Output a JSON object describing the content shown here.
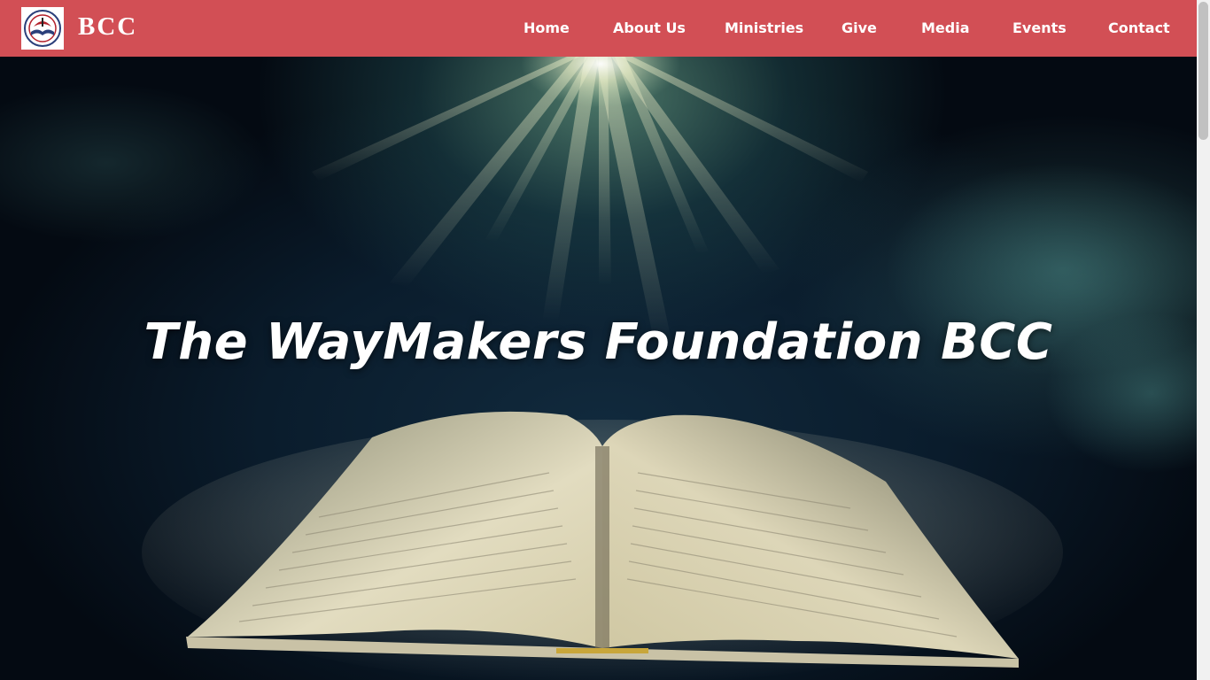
{
  "header": {
    "brand": "BCC",
    "logo_icon": "church-bible-logo-icon",
    "background_color": "#d24f55",
    "nav": [
      {
        "label": "Home"
      },
      {
        "label": "About Us"
      },
      {
        "label": "Ministries"
      },
      {
        "label": "Give"
      },
      {
        "label": "Media"
      },
      {
        "label": "Events"
      },
      {
        "label": "Contact"
      }
    ]
  },
  "hero": {
    "title": "The WayMakers Foundation BCC",
    "background_image": "open-bible-with-light-rays"
  }
}
